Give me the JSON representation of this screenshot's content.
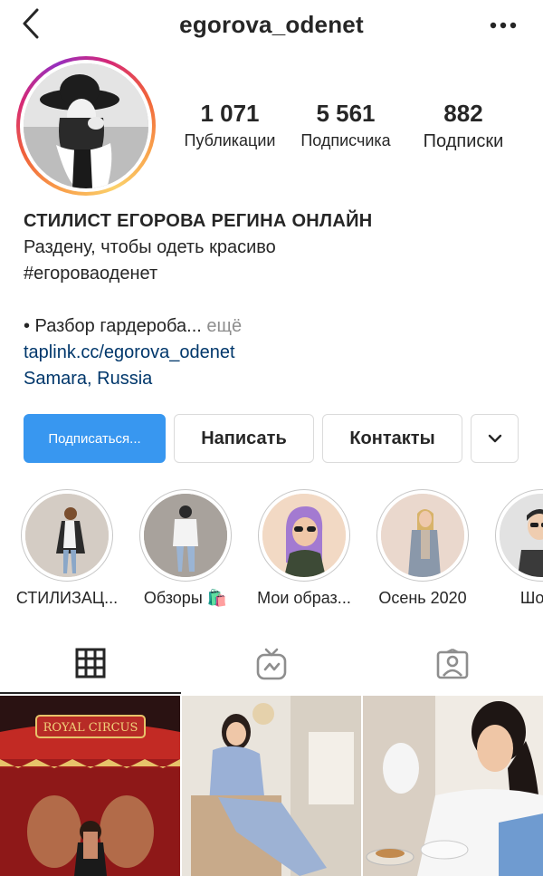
{
  "header": {
    "username": "egorova_odenet",
    "back_icon": "chevron-left-icon",
    "more_icon": "more-horizontal-icon"
  },
  "stats": {
    "posts": {
      "value": "1 071",
      "label": "Публикации"
    },
    "followers": {
      "value": "5 561",
      "label": "Подписчика"
    },
    "following": {
      "value": "882",
      "label": "Подписки"
    }
  },
  "bio": {
    "name": "СТИЛИСТ ЕГОРОВА РЕГИНА ОНЛАЙН",
    "line1": "Раздену, чтобы одеть красиво",
    "line2": "#егороваоденет",
    "line3": "• Разбор гардероба...",
    "more": " ещё",
    "link": "taplink.cc/egorova_odenet",
    "location": "Samara, Russia"
  },
  "buttons": {
    "follow": "Подписаться...",
    "message": "Написать",
    "contacts": "Контакты"
  },
  "highlights": [
    {
      "label": "СТИЛИЗАЦ..."
    },
    {
      "label": "Обзоры 🛍️"
    },
    {
      "label": "Мои образ..."
    },
    {
      "label": "Осень 2020"
    },
    {
      "label": "Шопи"
    }
  ],
  "tabs": [
    "grid-icon",
    "igtv-icon",
    "tagged-icon"
  ],
  "colors": {
    "accent_blue": "#3897f0",
    "link": "#00376b",
    "text": "#262626",
    "muted": "#8e8e8e",
    "border": "#dbdbdb"
  }
}
